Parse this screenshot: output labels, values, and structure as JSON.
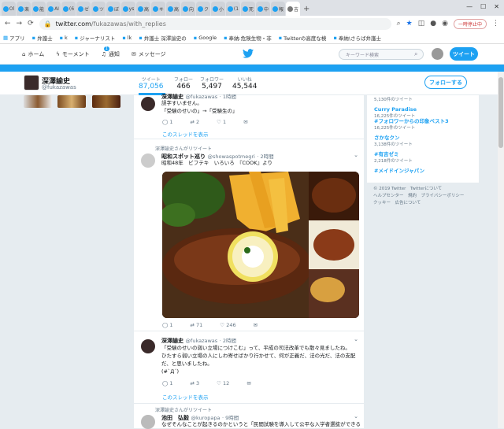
{
  "browser": {
    "tabs": [
      "Ol",
      "楽",
      "能",
      "AI",
      "(6",
      "ゼ",
      "ツ",
      "ぼ",
      "ys",
      "高",
      "キ",
      "高",
      "向",
      "ク",
      "小",
      "(1",
      "死",
      "中",
      "報",
      "吉"
    ],
    "url_host": "twitter.com",
    "url_path": "/fukazawas/with_replies",
    "pause_label": "一時停止中",
    "bookmarks": [
      "アプリ",
      "弁護士",
      "k",
      "ジャーナリスト",
      "lk",
      "弁護士 深澤諭史の",
      "Google",
      "奉納:危険生物・非",
      "Twitterの高度な検",
      "奉納\\さらば弁護士"
    ]
  },
  "nav": {
    "home": "ホーム",
    "moments": "モーメント",
    "notifications": "通知",
    "notif_count": "1",
    "messages": "メッセージ",
    "search_placeholder": "キーワード検索",
    "tweet_button": "ツイート"
  },
  "profile": {
    "name": "深澤諭史",
    "handle": "@fukazawas",
    "stats": [
      {
        "label": "ツイート",
        "value": "87,056"
      },
      {
        "label": "フォロー",
        "value": "466"
      },
      {
        "label": "フォロワー",
        "value": "5,497"
      },
      {
        "label": "いいね",
        "value": "45,544"
      }
    ],
    "follow_button": "フォローする"
  },
  "tweets": [
    {
      "name": "深澤諭史",
      "handle": "@fukazawas",
      "time": "1時間",
      "lines": [
        "誤字すいません。",
        "「受験のせいの」→「受験生の」"
      ],
      "replies": "1",
      "retweets": "2",
      "likes": "1",
      "thread_link": "このスレッドを表示"
    },
    {
      "retweeted_by": "深澤諭史さんがリツイート",
      "name": "昭和スポット巡り",
      "handle": "@showaspotmegri",
      "time": "2時間",
      "lines": [
        "昭和48年　ビフテキ　いろいろ　『COOK』より"
      ],
      "replies": "1",
      "retweets": "71",
      "likes": "246"
    },
    {
      "name": "深澤諭史",
      "handle": "@fukazawas",
      "time": "2時間",
      "lines": [
        "「受験のせいの弱い立場につけこむ」って、平成の司法改革でも散々見ましたね。",
        "ひたすら弱い立場の人にしわ寄せばかり行かせて、何が正義だ、法の光だ、法の支配",
        "だ、と思いましたね。",
        "(#`Д´)"
      ],
      "replies": "1",
      "retweets": "3",
      "likes": "12",
      "thread_link": "このスレッドを表示"
    },
    {
      "retweeted_by": "深澤諭史さんがリツイート",
      "name": "池田　弘毅",
      "handle": "@kuropapa",
      "time": "9時間",
      "lines": [
        "なぜそんなことが起きるのかというと「民間試験を導入して公平な入学者選抜ができると"
      ]
    }
  ],
  "trends": [
    {
      "title": "",
      "count": "5,130件のツイート"
    },
    {
      "title": "Curry Paradise",
      "count": "16,225件のツイート"
    },
    {
      "title": "#フォロワーからの印象ベスト3",
      "count": ""
    },
    {
      "title": "さかなクン",
      "count": "3,138件のツイート"
    },
    {
      "title": "#有吉ゼミ",
      "count": "2,218件のツイート"
    },
    {
      "title": "#メイドインジャパン",
      "count": ""
    }
  ],
  "footer": {
    "line1": "© 2019 Twitter　Twitterについて",
    "line2": "ヘルプセンター　規約　プライバシーポリシー",
    "line3": "クッキー　広告について"
  },
  "colors": {
    "accent": "#1da1f2",
    "bg": "#e6ecf0"
  }
}
